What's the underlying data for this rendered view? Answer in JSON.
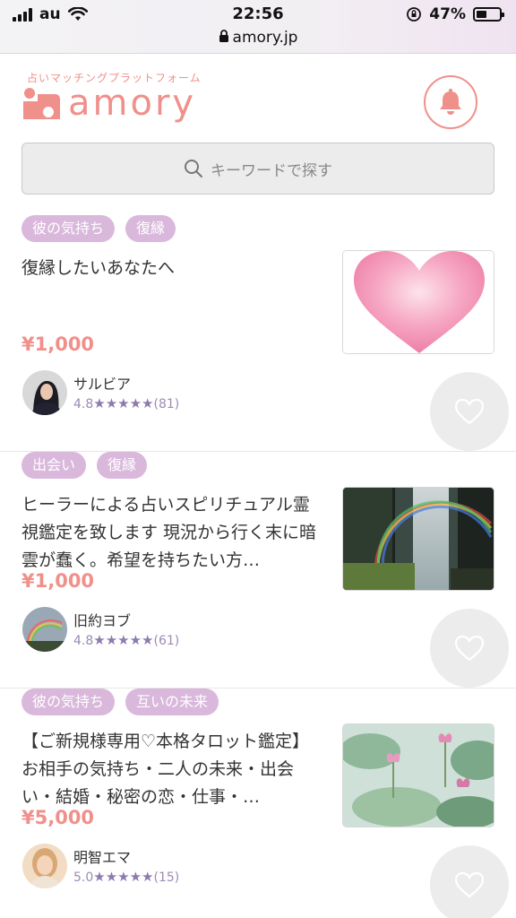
{
  "status_bar": {
    "carrier": "au",
    "time": "22:56",
    "url": "amory.jp",
    "battery": "47%",
    "battery_level": 0.47
  },
  "header": {
    "tagline": "占いマッチングプラットフォーム",
    "brand": "amory",
    "brand_color": "#f0908b"
  },
  "search": {
    "placeholder": "キーワードで探す"
  },
  "listings": [
    {
      "tags": [
        "彼の気持ち",
        "復縁"
      ],
      "title": "復縁したいあなたへ",
      "price": "¥1,000",
      "seller": "サルビア",
      "rating": "4.8",
      "stars": "★★★★★",
      "reviews": "(81)",
      "thumbnail": "heart-image"
    },
    {
      "tags": [
        "出会い",
        "復縁"
      ],
      "title": "ヒーラーによる占いスピリチュアル霊視鑑定を致します 現況から行く末に暗雲が蠢く。希望を持ちたい方…",
      "price": "¥1,000",
      "seller": "旧約ヨブ",
      "rating": "4.8",
      "stars": "★★★★★",
      "reviews": "(61)",
      "thumbnail": "waterfall-rainbow-image"
    },
    {
      "tags": [
        "彼の気持ち",
        "互いの未来"
      ],
      "title": "【ご新規様専用♡本格タロット鑑定】お相手の気持ち・二人の未来・出会い・結婚・秘密の恋・仕事・…",
      "price": "¥5,000",
      "seller": "明智エマ",
      "rating": "5.0",
      "stars": "★★★★★",
      "reviews": "(15)",
      "thumbnail": "lotus-pond-image"
    }
  ],
  "colors": {
    "tag_bg": "#d9b8dc",
    "price": "#f0908b",
    "rating": "#8d7aae"
  }
}
